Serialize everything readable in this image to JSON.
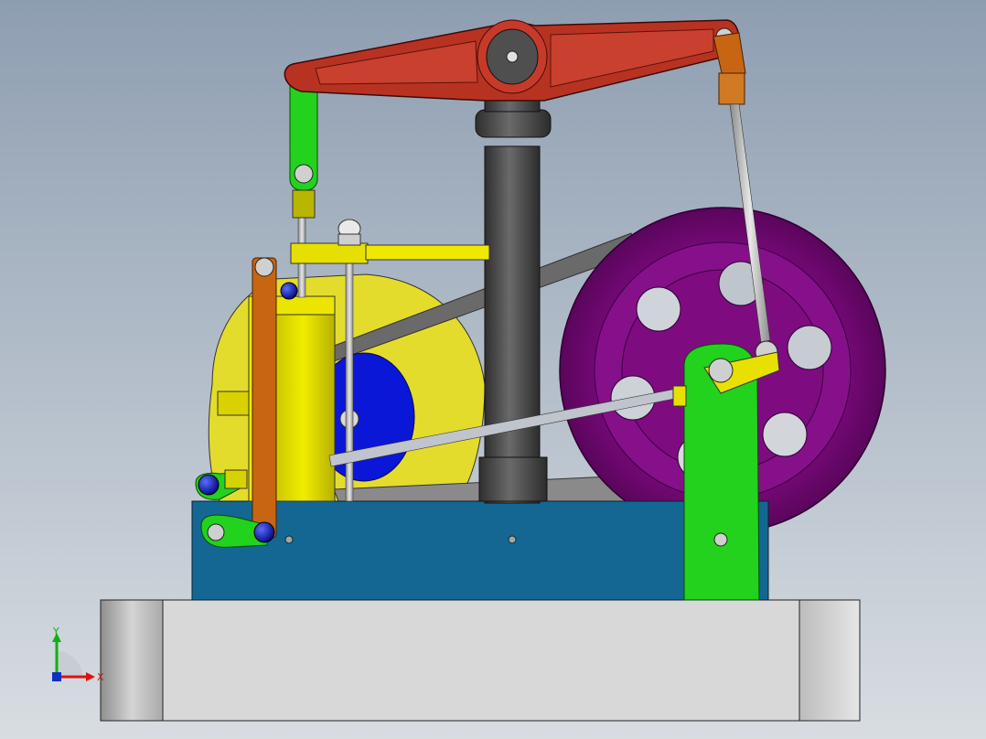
{
  "triad": {
    "x_label": "X",
    "y_label": "Y",
    "x_color": "#e01010",
    "y_color": "#10b010",
    "z_color": "#1030c0"
  },
  "colors": {
    "background_top": "#8f9fb2",
    "background_bottom": "#d7dce1",
    "beam": "#b83222",
    "column": "#4b4b4b",
    "flywheel": "#7a0a7c",
    "base_block": "#136792",
    "plinth": "#d9d9d9",
    "cylinder": "#e6e000",
    "eccentric_disc": "#0b17d6",
    "green_links": "#22d21c",
    "orange_links": "#c86513"
  },
  "icons": {
    "triad": "coordinate-triad-icon"
  }
}
